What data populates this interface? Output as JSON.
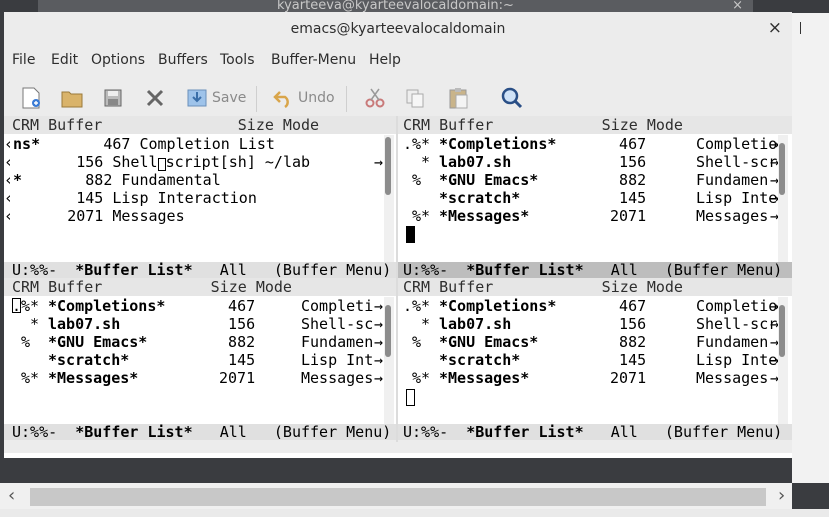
{
  "background_terminal": {
    "title": "kyarteeva@kyarteevalocaldomain:~",
    "close": "×"
  },
  "window": {
    "title": "emacs@kyarteevalocaldomain",
    "close": "×"
  },
  "menu": [
    "File",
    "Edit",
    "Options",
    "Buffers",
    "Tools",
    "Buffer-Menu",
    "Help"
  ],
  "toolbar": {
    "save": "Save",
    "undo": "Undo"
  },
  "panes": {
    "top_left": {
      "header": "CRM Buffer               Size Mode",
      "rows": [
        {
          "mark": "‹",
          "name": "ns*",
          "size_mode": "       467 Completion List"
        },
        {
          "mark": "‹",
          "name": "",
          "size_mode": "       156 Shell"
        },
        {
          "mark": "‹",
          "name": "*",
          "size_mode": "       882 Fundamental"
        },
        {
          "mark": "‹",
          "name": "",
          "size_mode": "       145 Lisp Interaction"
        },
        {
          "mark": "‹",
          "name": "",
          "size_mode": "      2071 Messages"
        }
      ],
      "row2_tail": "script[sh] ~/lab",
      "modeline": {
        "status": "U:%%-  ",
        "buffer": "*Buffer List*",
        "rest": "   All   (Buffer Menu)"
      }
    },
    "top_right": {
      "header": "CRM Buffer            Size Mode",
      "rows": [
        {
          "crm": ".%*",
          "name": "*Completions*",
          "size": "467",
          "mode": "Completio"
        },
        {
          "crm": "  *",
          "name": "lab07.sh",
          "size": "156",
          "mode": "Shell-scr"
        },
        {
          "crm": " % ",
          "name": "*GNU Emacs*",
          "size": "882",
          "mode": "Fundamen"
        },
        {
          "crm": "   ",
          "name": "*scratch*",
          "size": "145",
          "mode": "Lisp Inte"
        },
        {
          "crm": " %*",
          "name": "*Messages*",
          "size": "2071",
          "mode": "Messages"
        }
      ],
      "modeline": {
        "status": "U:%%-  ",
        "buffer": "*Buffer List*",
        "rest": "   All   (Buffer Menu)"
      }
    },
    "bottom_left": {
      "header": "CRM Buffer            Size Mode",
      "rows": [
        {
          "crm": ".%*",
          "name": "*Completions*",
          "size": "467",
          "mode": "Completi"
        },
        {
          "crm": "  *",
          "name": "lab07.sh",
          "size": "156",
          "mode": "Shell-sc"
        },
        {
          "crm": " % ",
          "name": "*GNU Emacs*",
          "size": "882",
          "mode": "Fundamen"
        },
        {
          "crm": "   ",
          "name": "*scratch*",
          "size": "145",
          "mode": "Lisp Int"
        },
        {
          "crm": " %*",
          "name": "*Messages*",
          "size": "2071",
          "mode": "Messages"
        }
      ],
      "modeline": {
        "status": "U:%%-  ",
        "buffer": "*Buffer List*",
        "rest": "   All   (Buffer Menu)"
      }
    },
    "bottom_right": {
      "header": "CRM Buffer            Size Mode",
      "rows": [
        {
          "crm": ".%*",
          "name": "*Completions*",
          "size": "467",
          "mode": "Completio"
        },
        {
          "crm": "  *",
          "name": "lab07.sh",
          "size": "156",
          "mode": "Shell-scr"
        },
        {
          "crm": " % ",
          "name": "*GNU Emacs*",
          "size": "882",
          "mode": "Fundamen"
        },
        {
          "crm": "   ",
          "name": "*scratch*",
          "size": "145",
          "mode": "Lisp Inte"
        },
        {
          "crm": " %*",
          "name": "*Messages*",
          "size": "2071",
          "mode": "Messages"
        }
      ],
      "modeline": {
        "status": "U:%%-  ",
        "buffer": "*Buffer List*",
        "rest": "   All   (Buffer Menu)"
      }
    }
  },
  "trunc_arrow": "→",
  "hscroll": {
    "left": "‹",
    "right": "›"
  }
}
